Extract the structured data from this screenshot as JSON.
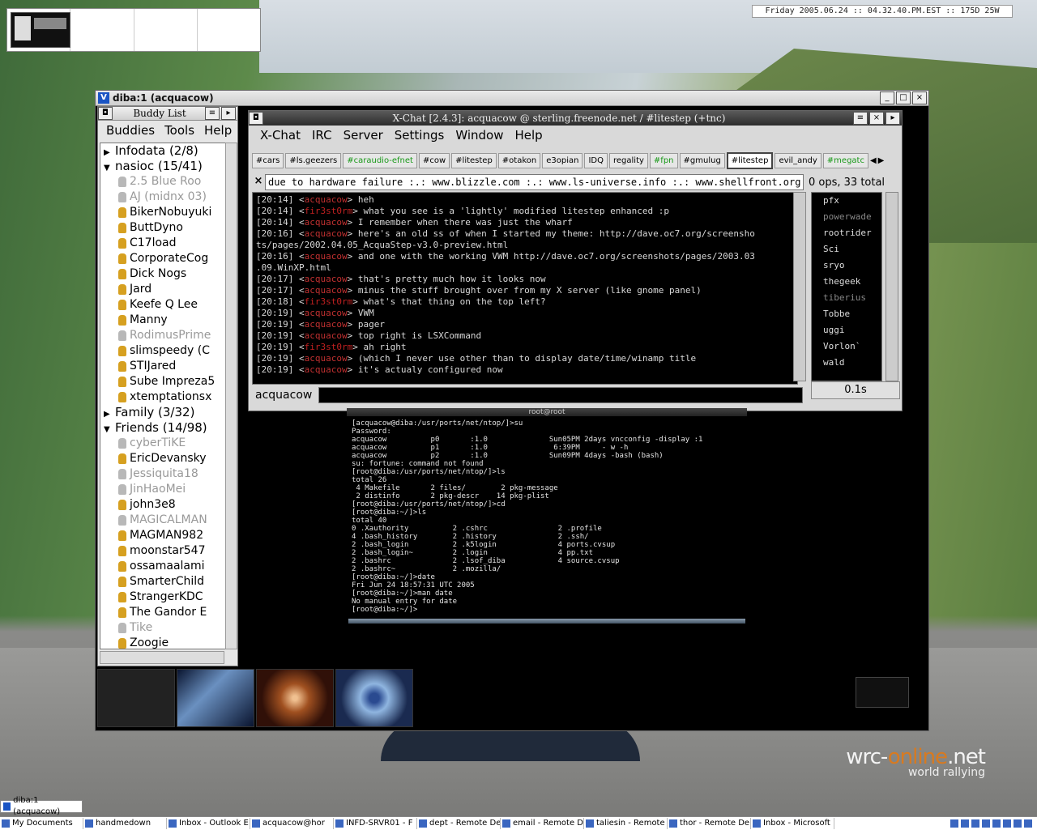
{
  "datebar": "Friday 2005.06.24 :: 04.32.40.PM.EST :: 175D 25W",
  "mainwin": {
    "title": "diba:1 (acquacow)"
  },
  "buddylist": {
    "title": "Buddy List",
    "menu": [
      "Buddies",
      "Tools",
      "Help"
    ],
    "groups": [
      {
        "name": "Infodata (2/8)",
        "expanded": false,
        "buddies": []
      },
      {
        "name": "nasioc (15/41)",
        "expanded": true,
        "buddies": [
          {
            "n": "2.5 Blue Roo",
            "idle": true
          },
          {
            "n": "AJ (midnx 03)",
            "idle": true
          },
          {
            "n": "BikerNobuyuki",
            "idle": false
          },
          {
            "n": "ButtDyno",
            "idle": false
          },
          {
            "n": "C17load",
            "idle": false
          },
          {
            "n": "CorporateCog",
            "idle": false
          },
          {
            "n": "Dick Nogs",
            "idle": false
          },
          {
            "n": "Jard",
            "idle": false
          },
          {
            "n": "Keefe Q Lee",
            "idle": false
          },
          {
            "n": "Manny",
            "idle": false
          },
          {
            "n": "RodimusPrime",
            "idle": true
          },
          {
            "n": "slimspeedy (C",
            "idle": false
          },
          {
            "n": "STIJared",
            "idle": false
          },
          {
            "n": "Sube Impreza5",
            "idle": false
          },
          {
            "n": "xtemptationsx",
            "idle": false
          }
        ]
      },
      {
        "name": "Family (3/32)",
        "expanded": false,
        "buddies": []
      },
      {
        "name": "Friends (14/98)",
        "expanded": true,
        "buddies": [
          {
            "n": "cyberTiKE",
            "idle": true
          },
          {
            "n": "EricDevansky",
            "idle": false
          },
          {
            "n": "Jessiquita18",
            "idle": true
          },
          {
            "n": "JinHaoMei",
            "idle": true
          },
          {
            "n": "john3e8",
            "idle": false
          },
          {
            "n": "MAGICALMAN",
            "idle": true
          },
          {
            "n": "MAGMAN982",
            "idle": false
          },
          {
            "n": "moonstar547",
            "idle": false
          },
          {
            "n": "ossamaalami",
            "idle": false
          },
          {
            "n": "SmarterChild",
            "idle": false
          },
          {
            "n": "StrangerKDC",
            "idle": false
          },
          {
            "n": "The Gandor E",
            "idle": false
          },
          {
            "n": "Tike",
            "idle": true
          },
          {
            "n": "Zoogie",
            "idle": false
          }
        ]
      }
    ]
  },
  "xchat": {
    "title": "X-Chat [2.4.3]: acquacow @ sterling.freenode.net / #litestep (+tnc)",
    "menu": [
      "X-Chat",
      "IRC",
      "Server",
      "Settings",
      "Window",
      "Help"
    ],
    "tabs": [
      {
        "l": "#cars",
        "c": ""
      },
      {
        "l": "#ls.geezers",
        "c": ""
      },
      {
        "l": "#caraudio-efnet",
        "c": "g"
      },
      {
        "l": "#cow",
        "c": ""
      },
      {
        "l": "#litestep",
        "c": ""
      },
      {
        "l": "#otakon",
        "c": ""
      },
      {
        "l": "e3opian",
        "c": ""
      },
      {
        "l": "IDQ",
        "c": ""
      },
      {
        "l": "regality",
        "c": ""
      },
      {
        "l": "#fpn",
        "c": "g"
      },
      {
        "l": "#gmulug",
        "c": ""
      },
      {
        "l": "#litestep",
        "c": "sel"
      },
      {
        "l": "evil_andy",
        "c": ""
      },
      {
        "l": "#megatc",
        "c": "g"
      }
    ],
    "topic": "due to hardware failure :.: www.blizzle.com :.: www.ls-universe.info :.: www.shellfront.org :.",
    "opcount": "0 ops, 33 total",
    "log": [
      {
        "t": "[20:14]",
        "n": "acquacow",
        "m": "heh"
      },
      {
        "t": "[20:14]",
        "n": "fir3st0rm",
        "m": "what you see is a 'lightly' modified litestep enhanced :p"
      },
      {
        "t": "[20:14]",
        "n": "acquacow",
        "m": "I remember when there was just the wharf"
      },
      {
        "t": "[20:16]",
        "n": "acquacow",
        "m": "here's an old ss of when I started my theme: http://dave.oc7.org/screensho"
      },
      {
        "t": "",
        "n": "",
        "m": " ts/pages/2002.04.05_AcquaStep-v3.0-preview.html"
      },
      {
        "t": "[20:16]",
        "n": "acquacow",
        "m": "and one with the working VWM http://dave.oc7.org/screenshots/pages/2003.03"
      },
      {
        "t": "",
        "n": "",
        "m": " .09.WinXP.html"
      },
      {
        "t": "[20:17]",
        "n": "acquacow",
        "m": "that's pretty much how it looks now"
      },
      {
        "t": "[20:17]",
        "n": "acquacow",
        "m": "minus the stuff brought over from my X server (like gnome panel)"
      },
      {
        "t": "[20:18]",
        "n": "fir3st0rm",
        "m": "what's that thing on the top left?"
      },
      {
        "t": "[20:19]",
        "n": "acquacow",
        "m": "VWM"
      },
      {
        "t": "[20:19]",
        "n": "acquacow",
        "m": "pager"
      },
      {
        "t": "[20:19]",
        "n": "acquacow",
        "m": "top right is LSXCommand"
      },
      {
        "t": "[20:19]",
        "n": "fir3st0rm",
        "m": "ah right"
      },
      {
        "t": "[20:19]",
        "n": "acquacow",
        "m": "(which I never use other than to display date/time/winamp title"
      },
      {
        "t": "[20:19]",
        "n": "acquacow",
        "m": "it's actualy configured now"
      }
    ],
    "users": [
      {
        "n": "pfx",
        "idle": false
      },
      {
        "n": "powerwade",
        "idle": true
      },
      {
        "n": "rootrider",
        "idle": false
      },
      {
        "n": "Sci",
        "idle": false
      },
      {
        "n": "sryo",
        "idle": false
      },
      {
        "n": "thegeek",
        "idle": false
      },
      {
        "n": "tiberius",
        "idle": true
      },
      {
        "n": "Tobbe",
        "idle": false
      },
      {
        "n": "uggi",
        "idle": false
      },
      {
        "n": "Vorlon`",
        "idle": false
      },
      {
        "n": "wald",
        "idle": false
      }
    ],
    "nick": "acquacow",
    "lag": "0.1s"
  },
  "terminal": {
    "title": "root@root",
    "text": "[acquacow@diba:/usr/ports/net/ntop/]>su\nPassword:\nacquacow          p0       :1.0              Sun05PM 2days vncconfig -display :1\nacquacow          p1       :1.0               6:39PM     - w -h\nacquacow          p2       :1.0              Sun09PM 4days -bash (bash)\nsu: fortune: command not found\n[root@diba:/usr/ports/net/ntop/]>ls\ntotal 26\n 4 Makefile       2 files/        2 pkg-message\n 2 distinfo       2 pkg-descr    14 pkg-plist\n[root@diba:/usr/ports/net/ntop/]>cd\n[root@diba:~/]>ls\ntotal 40\n0 .Xauthority          2 .cshrc                2 .profile\n4 .bash_history        2 .history              2 .ssh/\n2 .bash_login          2 .k5login              4 ports.cvsup\n2 .bash_login~         2 .login                4 pp.txt\n2 .bashrc              2 .lsof_diba            4 source.cvsup\n2 .bashrc~             2 .mozilla/\n[root@diba:~/]>date\nFri Jun 24 18:57:31 UTC 2005\n[root@diba:~/]>man date\nNo manual entry for date\n[root@diba:~/]>"
  },
  "logo": {
    "main_a": "wrc-",
    "main_b": "online",
    "main_c": ".net",
    "sub": "world rallying"
  },
  "taskbar_top": {
    "label": "diba:1 (acquacow)"
  },
  "taskbar": [
    "My Documents",
    "handmedown",
    "Inbox - Outlook E",
    "acquacow@hor",
    "INFD-SRVR01 - F",
    "dept - Remote De",
    "email - Remote D",
    "taliesin - Remote",
    "thor - Remote De",
    "Inbox - Microsoft"
  ]
}
